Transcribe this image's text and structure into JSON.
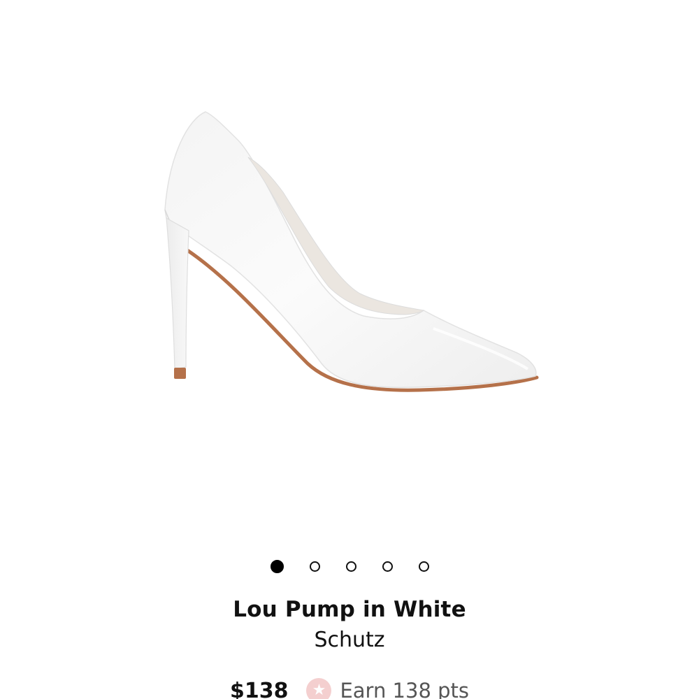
{
  "product": {
    "title": "Lou Pump in White",
    "brand": "Schutz",
    "price": "$138",
    "rewards_text": "Earn 138 pts",
    "image_subject": "white-pointed-toe-pump"
  },
  "carousel": {
    "total_images": 5,
    "active_index": 0
  },
  "colors": {
    "text": "#111111",
    "dot_active": "#000000",
    "rewards_icon_bg": "#f4cfcf",
    "rewards_text": "#555555",
    "sole": "#b5714a"
  }
}
